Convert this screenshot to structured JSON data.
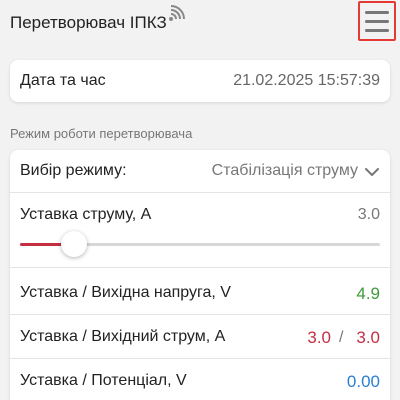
{
  "header": {
    "title": "Перетворювач ІПКЗ",
    "menu_icon": "hamburger-menu-icon",
    "signal_icon": "wifi-signal-icon"
  },
  "datetime": {
    "label": "Дата та час",
    "value": "21.02.2025 15:57:39"
  },
  "section": {
    "title": "Режим роботи перетворювача"
  },
  "mode_select": {
    "label": "Вибір режиму:",
    "value": "Стабілізація струму"
  },
  "current_setpoint": {
    "label": "Уставка струму, А",
    "value": "3.0",
    "slider_fraction": 0.15
  },
  "rows": {
    "voltage": {
      "label": "Уставка / Вихідна напруга, V",
      "value": "4.9"
    },
    "current": {
      "label": "Уставка / Вихідний струм, А",
      "setpoint": "3.0",
      "separator": "/",
      "actual": "3.0"
    },
    "potential": {
      "label": "Уставка / Потенціал, V",
      "value": "0.00"
    }
  },
  "colors": {
    "accent": "#c62f42",
    "green": "#3f9a3a",
    "blue": "#2a7fd4",
    "menu_border": "#e53935"
  }
}
